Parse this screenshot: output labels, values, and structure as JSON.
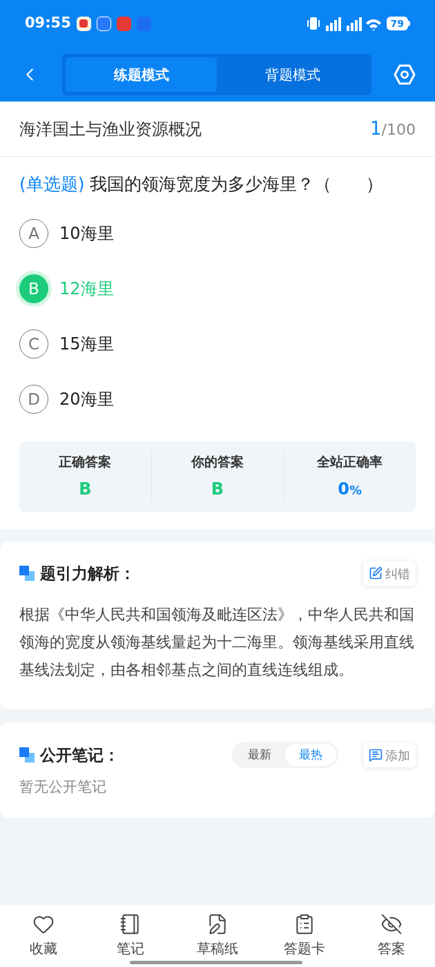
{
  "status_bar": {
    "time": "09:55",
    "battery": "79"
  },
  "header": {
    "tabs": [
      {
        "label": "练题模式",
        "selected": true
      },
      {
        "label": "背题模式",
        "selected": false
      }
    ]
  },
  "chapter": {
    "title": "海洋国土与渔业资源概况",
    "current": "1",
    "total": "/100"
  },
  "question": {
    "type": "(单选题)",
    "text": "我国的领海宽度为多少海里？（　　）"
  },
  "options": [
    {
      "letter": "A",
      "text": "10海里",
      "selected": false
    },
    {
      "letter": "B",
      "text": "12海里",
      "selected": true
    },
    {
      "letter": "C",
      "text": "15海里",
      "selected": false
    },
    {
      "letter": "D",
      "text": "20海里",
      "selected": false
    }
  ],
  "result": [
    {
      "label": "正确答案",
      "value": "B",
      "kind": "letter"
    },
    {
      "label": "你的答案",
      "value": "B",
      "kind": "letter"
    },
    {
      "label": "全站正确率",
      "value": "0",
      "unit": "%",
      "kind": "rate"
    }
  ],
  "analysis": {
    "title": "题引力解析：",
    "action": "纠错",
    "body": "根据《中华人民共和国领海及毗连区法》，中华人民共和国领海的宽度从领海基线量起为十二海里。领海基线采用直线基线法划定，由各相邻基点之间的直线连线组成。"
  },
  "notes": {
    "title": "公开笔记：",
    "sort": [
      {
        "label": "最新",
        "selected": false
      },
      {
        "label": "最热",
        "selected": true
      }
    ],
    "action": "添加",
    "empty": "暂无公开笔记"
  },
  "bottom_nav": [
    {
      "label": "收藏",
      "kind": "favorite"
    },
    {
      "label": "笔记",
      "kind": "note"
    },
    {
      "label": "草稿纸",
      "kind": "draft"
    },
    {
      "label": "答题卡",
      "kind": "card"
    },
    {
      "label": "答案",
      "kind": "answer"
    }
  ]
}
